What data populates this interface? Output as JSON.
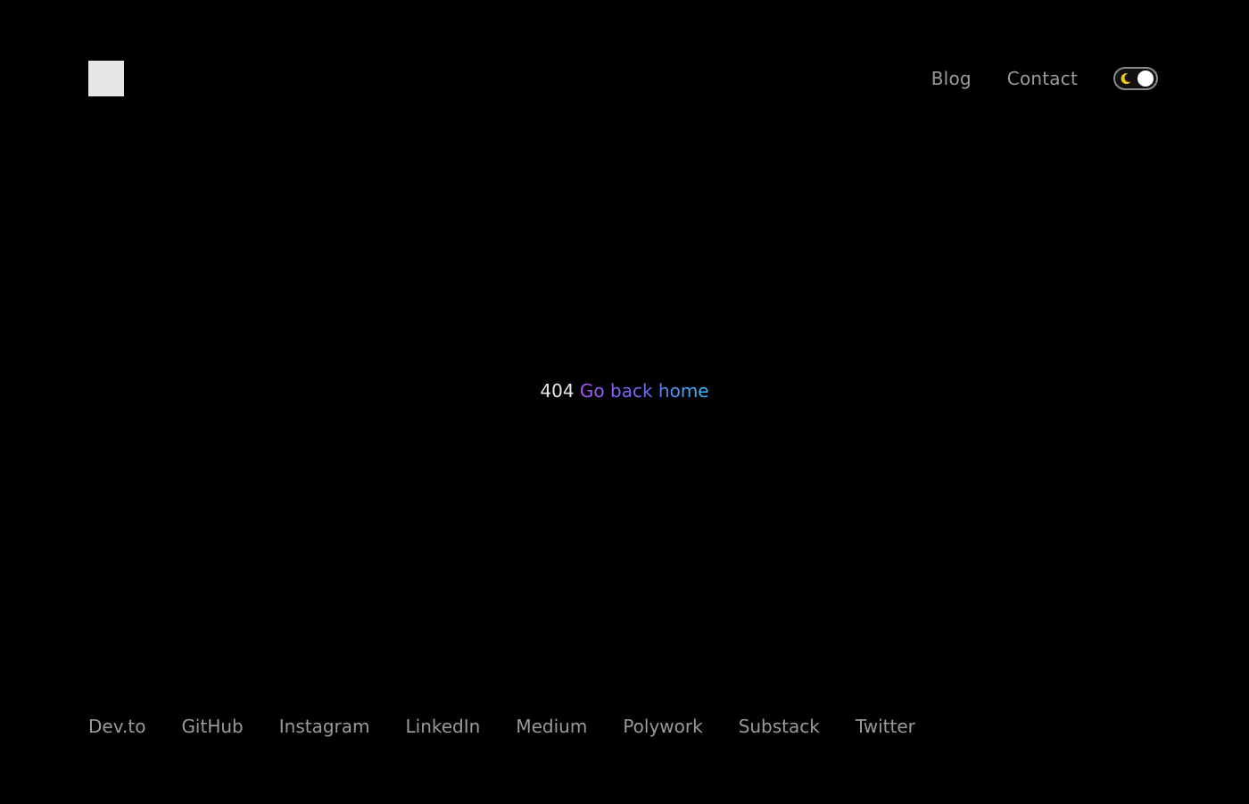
{
  "header": {
    "nav": [
      {
        "label": "Blog"
      },
      {
        "label": "Contact"
      }
    ],
    "theme_toggle": {
      "icon": "moon-icon",
      "state": "dark",
      "moon_color": "#f5c518"
    }
  },
  "main": {
    "code": "404",
    "link_label": "Go back home",
    "link_gradient": [
      "#a855f7",
      "#6d6cf5",
      "#38bdf8"
    ]
  },
  "footer": {
    "links": [
      {
        "label": "Dev.to"
      },
      {
        "label": "GitHub"
      },
      {
        "label": "Instagram"
      },
      {
        "label": "LinkedIn"
      },
      {
        "label": "Medium"
      },
      {
        "label": "Polywork"
      },
      {
        "label": "Substack"
      },
      {
        "label": "Twitter"
      }
    ]
  },
  "colors": {
    "background": "#000000",
    "nav_text": "#9a9a9a",
    "logo": "#e6e6e6"
  }
}
